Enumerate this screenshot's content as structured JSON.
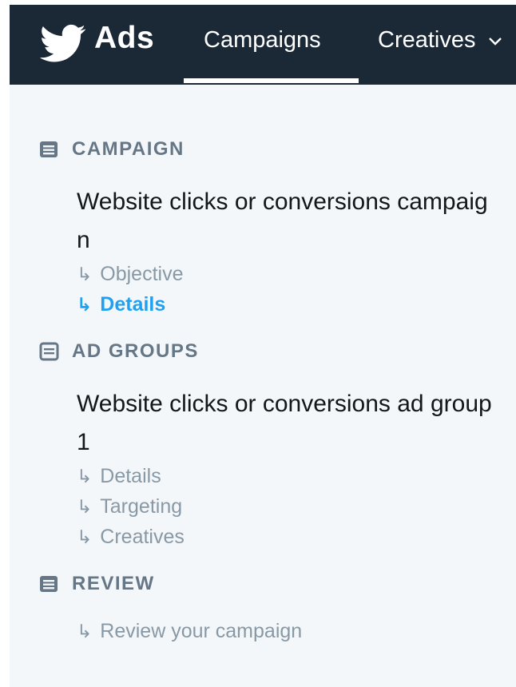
{
  "header": {
    "brand": "Ads",
    "tabs": [
      {
        "label": "Campaigns",
        "active": true
      },
      {
        "label": "Creatives",
        "active": false
      }
    ],
    "background_color": "#1b2836"
  },
  "sections": [
    {
      "title": "CAMPAIGN",
      "entity": "Website clicks or conversions campaign",
      "steps": [
        {
          "label": "Objective",
          "active": false
        },
        {
          "label": "Details",
          "active": true
        }
      ]
    },
    {
      "title": "AD GROUPS",
      "entity": "Website clicks or conversions ad group 1",
      "steps": [
        {
          "label": "Details",
          "active": false
        },
        {
          "label": "Targeting",
          "active": false
        },
        {
          "label": "Creatives",
          "active": false
        }
      ]
    },
    {
      "title": "REVIEW",
      "steps": [
        {
          "label": "Review your campaign",
          "active": false
        }
      ]
    }
  ],
  "step_arrow": "↳",
  "colors": {
    "accent": "#1da1f2",
    "muted": "#8899a6",
    "section_heading": "#657786",
    "sidebar_background": "#f4f7fa"
  }
}
